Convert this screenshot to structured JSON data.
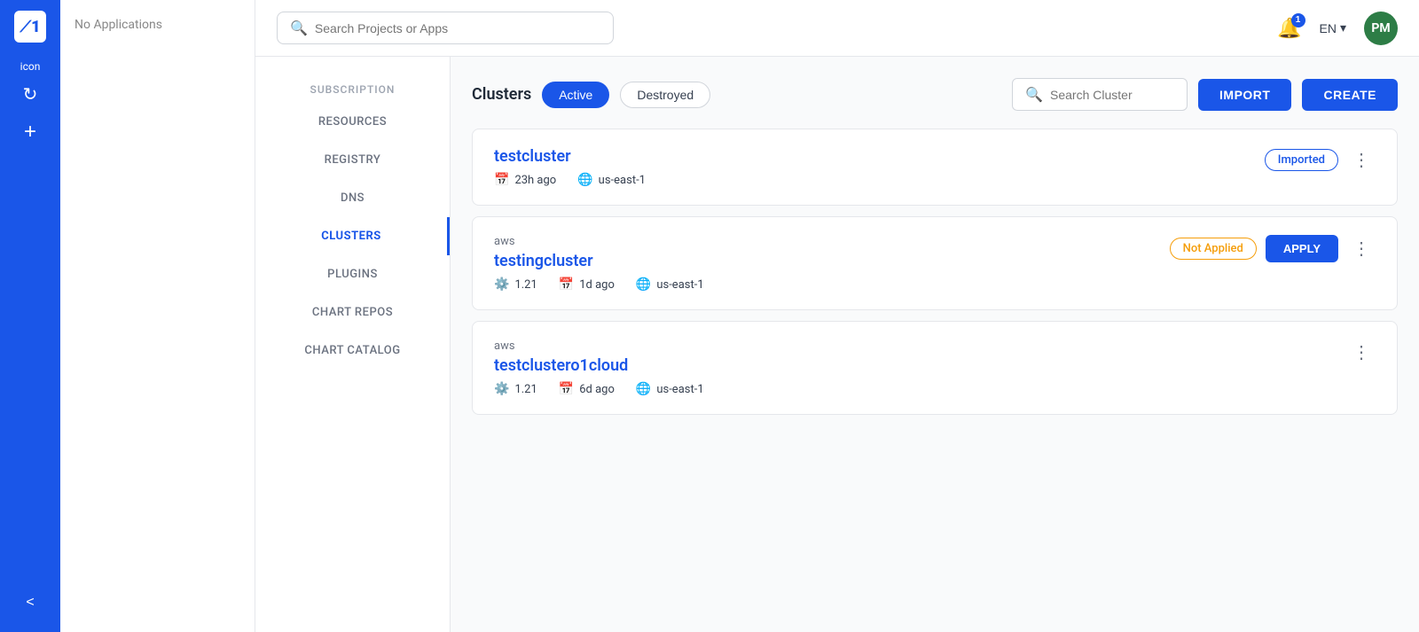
{
  "app": {
    "logo_text": "icon",
    "logo_mark": "⟋1"
  },
  "sidebar_left": {
    "add_label": "+",
    "collapse_label": "<"
  },
  "sidebar_second": {
    "no_apps_label": "No Applications"
  },
  "topbar": {
    "search_placeholder": "Search Projects or Apps",
    "notification_count": "1",
    "language": "EN",
    "avatar_initials": "PM"
  },
  "nav": {
    "subscription_label": "SUBSCRIPTION",
    "items": [
      {
        "id": "resources",
        "label": "RESOURCES"
      },
      {
        "id": "registry",
        "label": "REGISTRY"
      },
      {
        "id": "dns",
        "label": "DNS"
      },
      {
        "id": "clusters",
        "label": "CLUSTERS",
        "active": true
      },
      {
        "id": "plugins",
        "label": "PLUGINS"
      },
      {
        "id": "chart-repos",
        "label": "CHART REPOS"
      },
      {
        "id": "chart-catalog",
        "label": "CHART CATALOG"
      }
    ]
  },
  "clusters_page": {
    "title": "Clusters",
    "tab_active": "Active",
    "tab_destroyed": "Destroyed",
    "search_placeholder": "Search Cluster",
    "import_label": "IMPORT",
    "create_label": "CREATE",
    "clusters": [
      {
        "id": "testcluster",
        "name": "testcluster",
        "provider": "",
        "version": "",
        "age": "23h ago",
        "region": "us-east-1",
        "status": "Imported",
        "has_apply": false
      },
      {
        "id": "testingcluster",
        "name": "testingcluster",
        "provider": "aws",
        "version": "1.21",
        "age": "1d ago",
        "region": "us-east-1",
        "status": "Not Applied",
        "has_apply": true
      },
      {
        "id": "testclustero1cloud",
        "name": "testclustero1cloud",
        "provider": "aws",
        "version": "1.21",
        "age": "6d ago",
        "region": "us-east-1",
        "status": "",
        "has_apply": false
      }
    ]
  }
}
